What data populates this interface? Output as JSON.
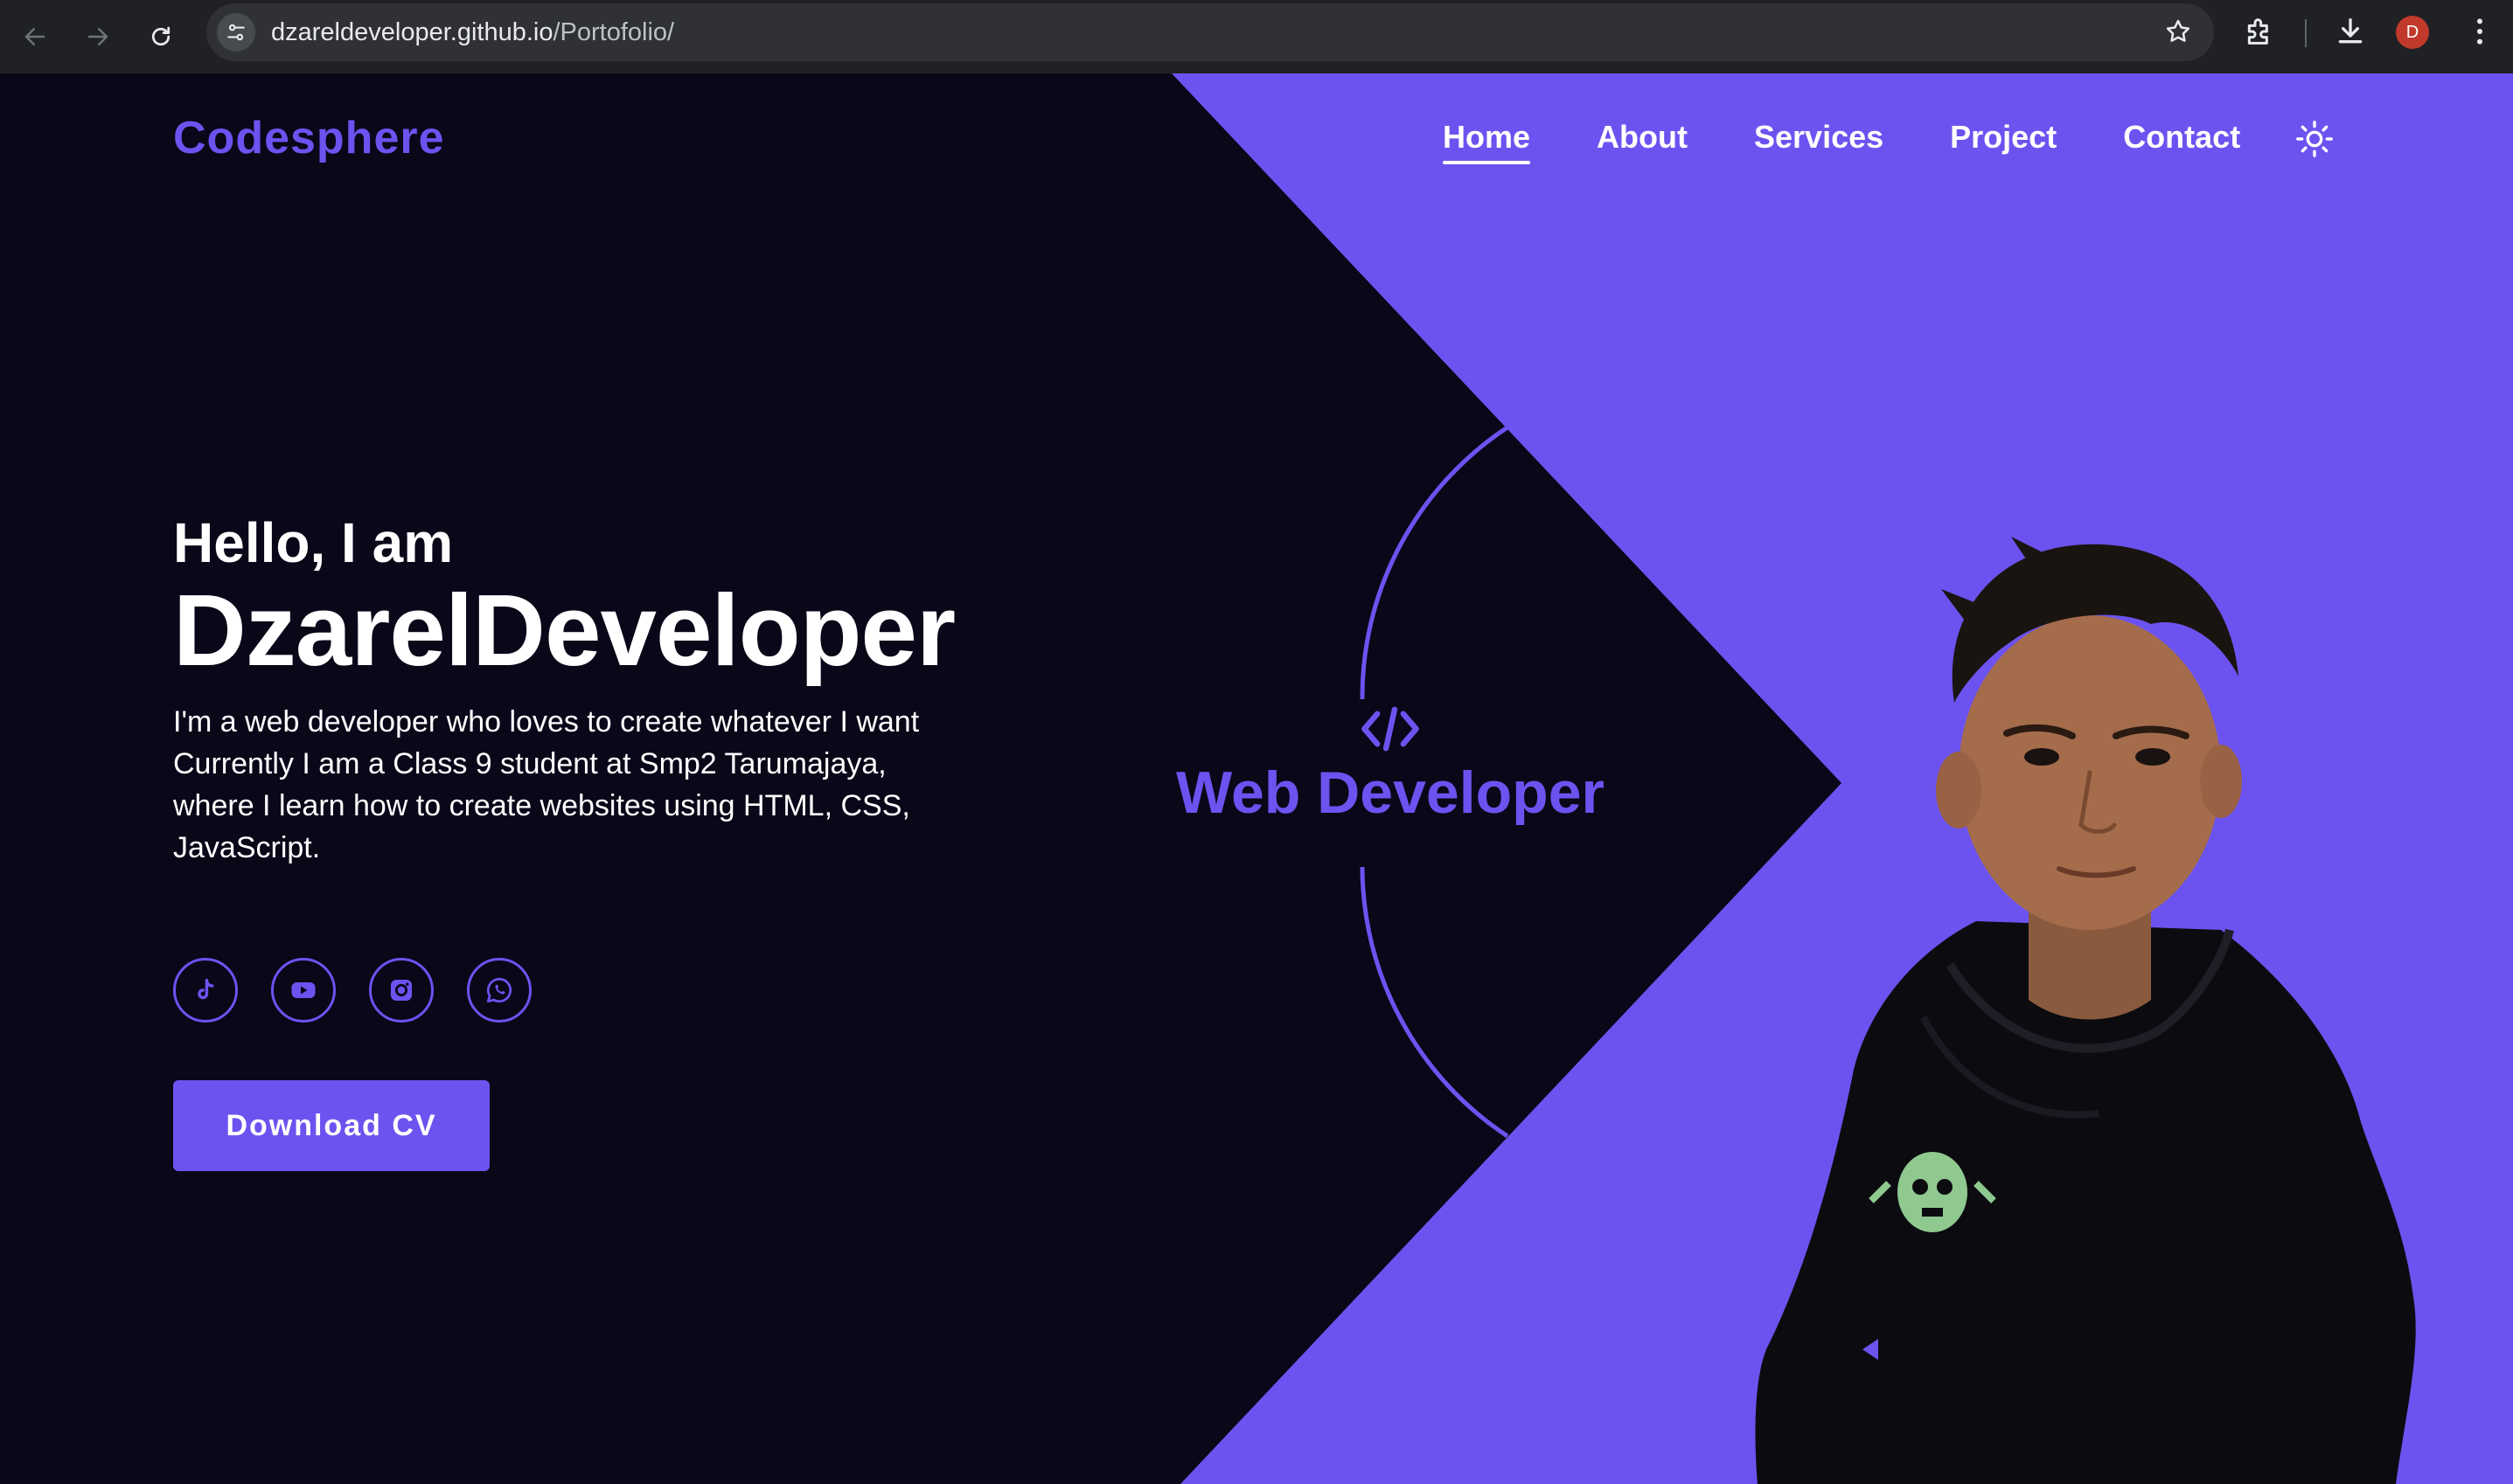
{
  "browser": {
    "url_host": "dzareldeveloper.github.io",
    "url_path": "/Portofolio/",
    "profile_initial": "D"
  },
  "site": {
    "logo": "Codesphere",
    "nav": [
      {
        "label": "Home",
        "active": true
      },
      {
        "label": "About"
      },
      {
        "label": "Services"
      },
      {
        "label": "Project"
      },
      {
        "label": "Contact"
      }
    ],
    "theme_icon": "sun-icon"
  },
  "hero": {
    "greeting": "Hello, I am",
    "name": "DzarelDeveloper",
    "bio_line1": "I'm a web developer who loves to create whatever I want",
    "bio_line2": "Currently I am a Class 9 student at Smp2 Tarumajaya, where I learn how to create websites using HTML, CSS, JavaScript.",
    "socials": [
      "tiktok-icon",
      "youtube-icon",
      "instagram-icon",
      "whatsapp-icon"
    ],
    "cv_button": "Download CV",
    "role": "Web Developer",
    "role_icon": "code-icon"
  },
  "colors": {
    "accent": "#6c53f0",
    "background": "#0a0719",
    "text": "#ffffff"
  }
}
